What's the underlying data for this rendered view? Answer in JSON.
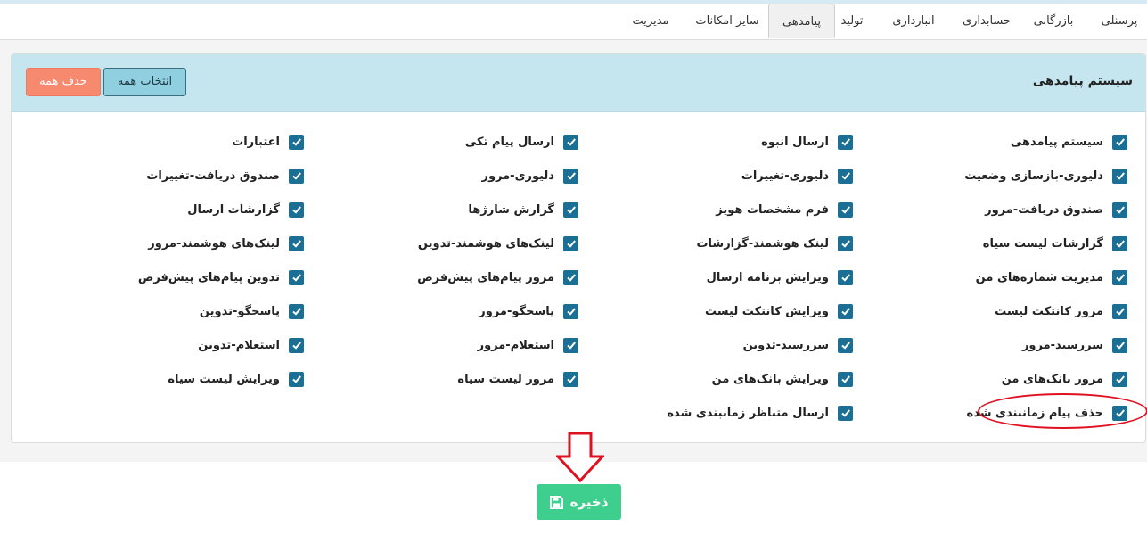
{
  "tabs": [
    {
      "label": "پرسنلی",
      "active": false
    },
    {
      "label": "بازرگانی",
      "active": false
    },
    {
      "label": "حسابداری",
      "active": false
    },
    {
      "label": "انبارداری",
      "active": false
    },
    {
      "label": "تولید",
      "active": false
    },
    {
      "label": "پیامدهی",
      "active": true
    },
    {
      "label": "سایر امکانات",
      "active": false
    },
    {
      "label": "مدیریت",
      "active": false
    }
  ],
  "panel": {
    "title": "سیستم پیامدهی",
    "select_all_label": "انتخاب همه",
    "delete_all_label": "حذف همه"
  },
  "permissions": {
    "col1": [
      {
        "label": "سیستم پیامدهی",
        "checked": true
      },
      {
        "label": "دلیوری-بازسازی وضعیت",
        "checked": true
      },
      {
        "label": "صندوق دریافت-مرور",
        "checked": true
      },
      {
        "label": "گزارشات لیست سیاه",
        "checked": true
      },
      {
        "label": "مدیریت شماره‌های من",
        "checked": true
      },
      {
        "label": "مرور کانتکت لیست",
        "checked": true
      },
      {
        "label": "سررسید-مرور",
        "checked": true
      },
      {
        "label": "مرور بانک‌های من",
        "checked": true
      },
      {
        "label": "حذف پیام زمانبندی شده",
        "checked": true
      }
    ],
    "col2": [
      {
        "label": "ارسال انبوه",
        "checked": true
      },
      {
        "label": "دلیوری-تغییرات",
        "checked": true
      },
      {
        "label": "فرم مشخصات هویز",
        "checked": true
      },
      {
        "label": "لینک هوشمند-گزارشات",
        "checked": true
      },
      {
        "label": "ویرایش برنامه ارسال",
        "checked": true
      },
      {
        "label": "ویرایش کانتکت لیست",
        "checked": true
      },
      {
        "label": "سررسید-تدوین",
        "checked": true
      },
      {
        "label": "ویرایش بانک‌های من",
        "checked": true
      },
      {
        "label": "ارسال متناظر زمانبندی شده",
        "checked": true
      }
    ],
    "col3": [
      {
        "label": "ارسال پیام تکی",
        "checked": true
      },
      {
        "label": "دلیوری-مرور",
        "checked": true
      },
      {
        "label": "گزارش شارژها",
        "checked": true
      },
      {
        "label": "لینک‌های هوشمند-تدوین",
        "checked": true
      },
      {
        "label": "مرور پیام‌های پیش‌فرض",
        "checked": true
      },
      {
        "label": "پاسخگو-مرور",
        "checked": true
      },
      {
        "label": "استعلام-مرور",
        "checked": true
      },
      {
        "label": "مرور لیست سیاه",
        "checked": true
      }
    ],
    "col4": [
      {
        "label": "اعتبارات",
        "checked": true
      },
      {
        "label": "صندوق دریافت-تغییرات",
        "checked": true
      },
      {
        "label": "گزارشات ارسال",
        "checked": true
      },
      {
        "label": "لینک‌های هوشمند-مرور",
        "checked": true
      },
      {
        "label": "تدوین پیام‌های پیش‌فرض",
        "checked": true
      },
      {
        "label": "پاسخگو-تدوین",
        "checked": true
      },
      {
        "label": "استعلام-تدوین",
        "checked": true
      },
      {
        "label": "ویرایش لیست سیاه",
        "checked": true
      }
    ]
  },
  "save_label": "ذخیره",
  "colors": {
    "checkbox": "#1b6f95",
    "panel_header": "#c5e6ef",
    "delete_button": "#f7896e",
    "save_button": "#3ecf8e",
    "annotation": "#e01020"
  }
}
